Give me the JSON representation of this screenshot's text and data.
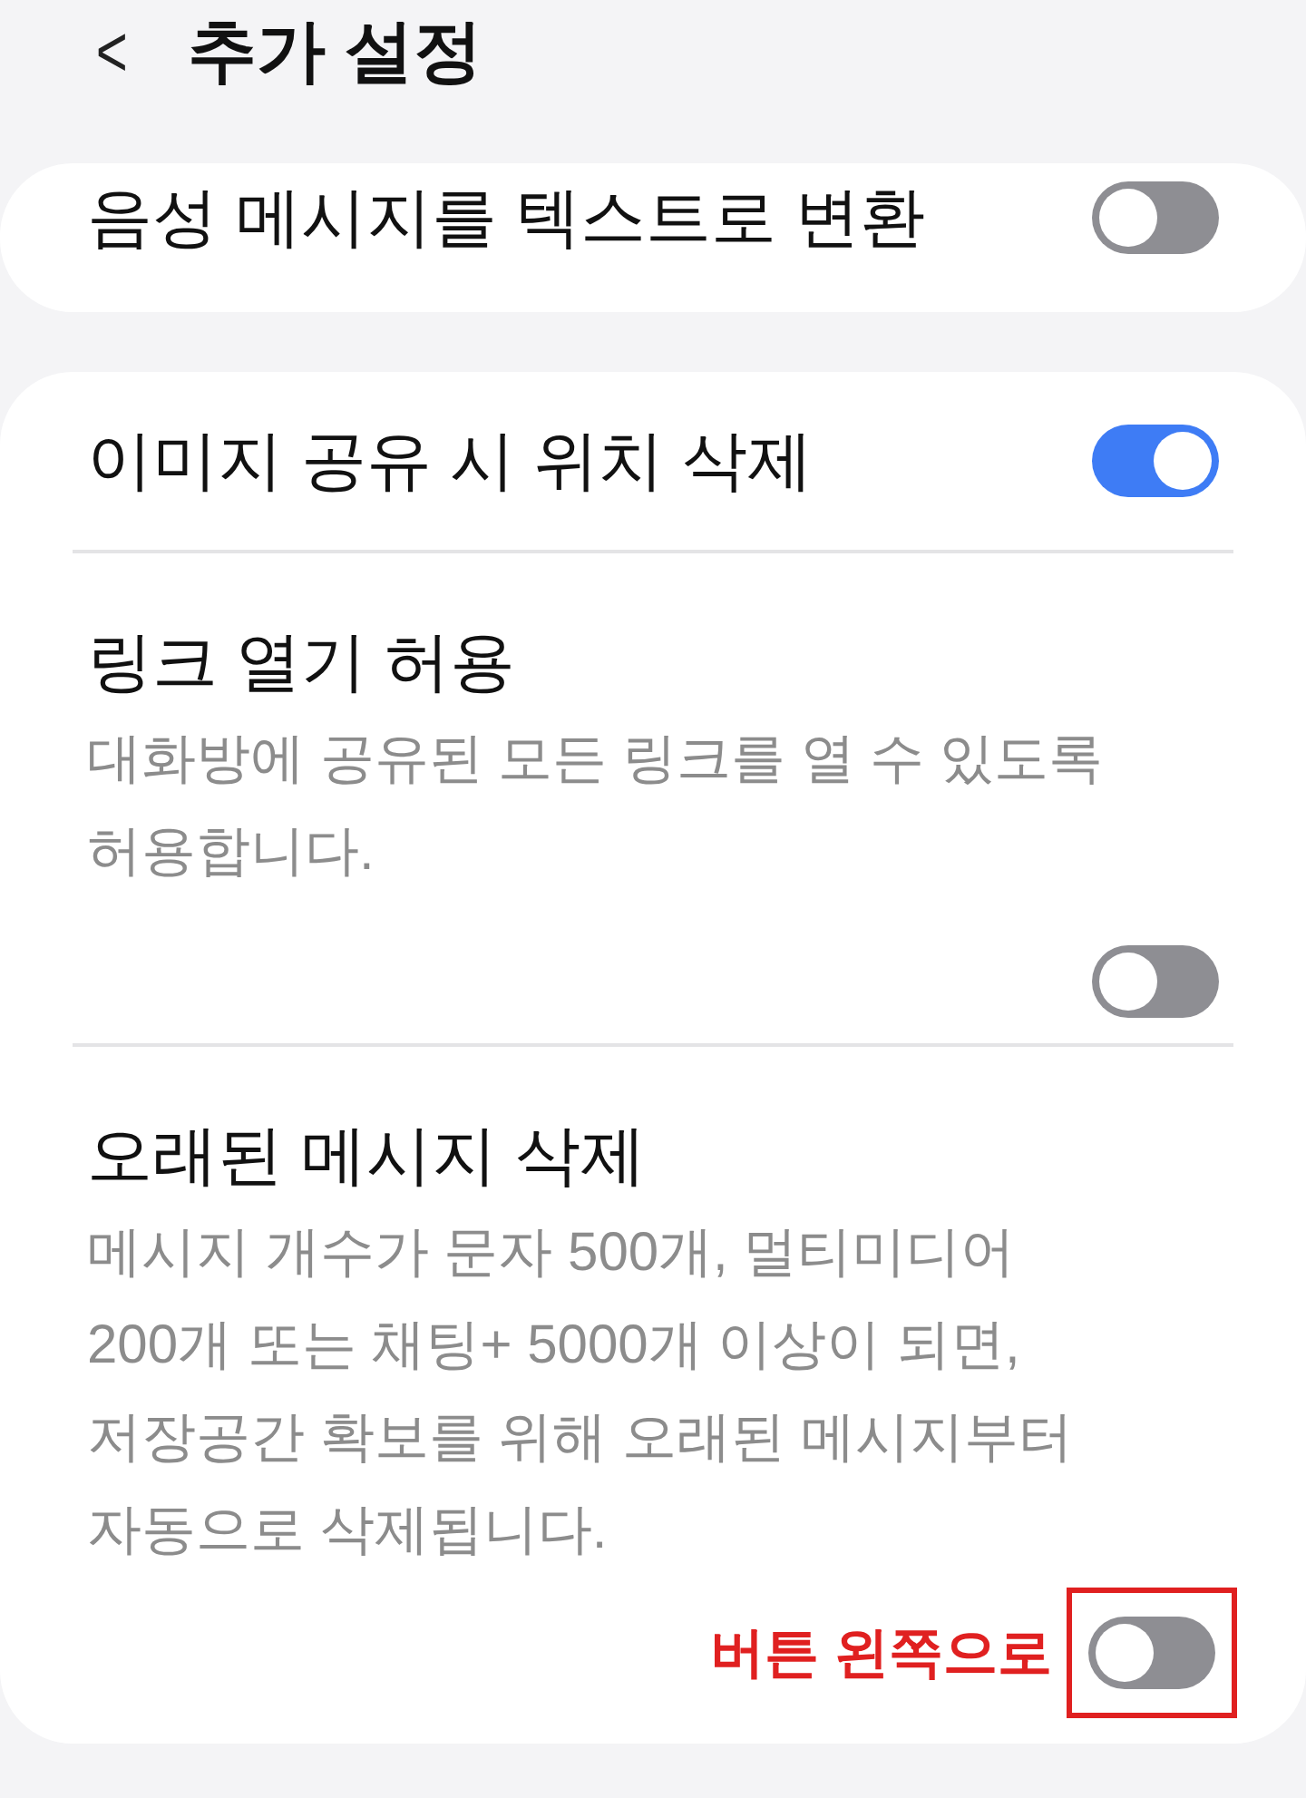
{
  "header": {
    "back": "<",
    "title": "추가 설정"
  },
  "cards": [
    {
      "rows": [
        {
          "title": "음성 메시지를 텍스트로 변환",
          "on": false,
          "highlighted": false
        }
      ]
    },
    {
      "rows": [
        {
          "title": "이미지 공유 시 위치 삭제",
          "on": true,
          "highlighted": false
        },
        {
          "title": "링크 열기 허용",
          "description": "대화방에 공유된 모든 링크를 열 수 있도록 허용합니다.",
          "on": false,
          "highlighted": false
        },
        {
          "title": "오래된 메시지 삭제",
          "description": "메시지 개수가 문자 500개, 멀티미디어 200개 또는 채팅+ 5000개 이상이 되면, 저장공간 확보를 위해 오래된 메시지부터 자동으로 삭제됩니다.",
          "on": false,
          "highlighted": true,
          "annotation": "버튼 왼쪽으로"
        }
      ]
    }
  ]
}
